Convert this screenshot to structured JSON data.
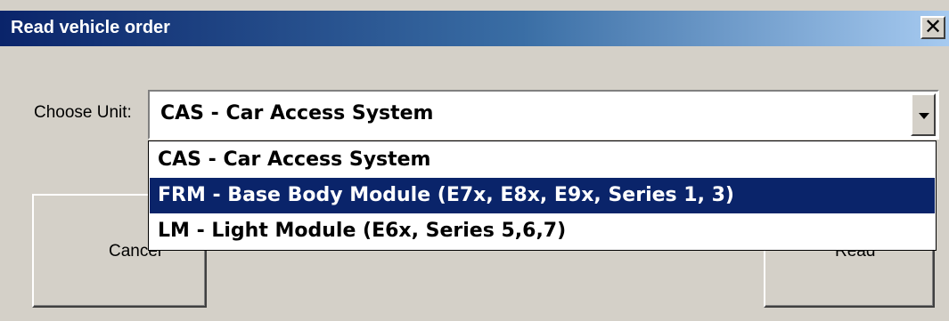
{
  "window": {
    "title": "Read vehicle order",
    "close_glyph": "✕"
  },
  "form": {
    "choose_label": "Choose Unit:",
    "selected_unit": "CAS - Car Access System",
    "options": [
      "CAS - Car Access System",
      "FRM - Base Body Module (E7x, E8x, E9x, Series 1, 3)",
      "LM - Light Module (E6x, Series 5,6,7)"
    ],
    "highlighted_index": 1
  },
  "buttons": {
    "cancel": "Cancel",
    "read": "Read"
  },
  "colors": {
    "selection": "#0a246a",
    "dialog_bg": "#d4d0c8",
    "title_gradient_start": "#0a246a",
    "title_gradient_end": "#a6caf0"
  },
  "icons": {
    "close": "close-icon",
    "dropdown": "chevron-down-icon"
  }
}
